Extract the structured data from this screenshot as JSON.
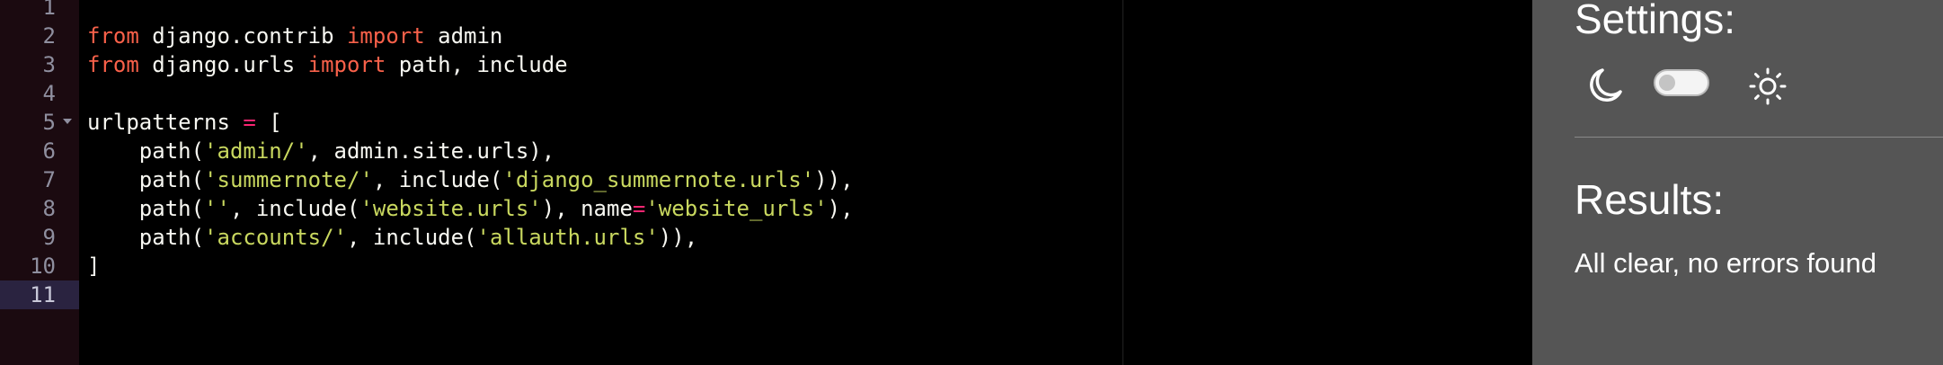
{
  "editor": {
    "lines": [
      {
        "num": "1",
        "tokens": []
      },
      {
        "num": "2",
        "tokens": [
          {
            "t": "from",
            "c": "kw"
          },
          {
            "t": " django.contrib ",
            "c": ""
          },
          {
            "t": "import",
            "c": "kw"
          },
          {
            "t": " admin",
            "c": ""
          }
        ]
      },
      {
        "num": "3",
        "tokens": [
          {
            "t": "from",
            "c": "kw"
          },
          {
            "t": " django.urls ",
            "c": ""
          },
          {
            "t": "import",
            "c": "kw"
          },
          {
            "t": " path, include",
            "c": ""
          }
        ]
      },
      {
        "num": "4",
        "tokens": []
      },
      {
        "num": "5",
        "fold": true,
        "tokens": [
          {
            "t": "urlpatterns ",
            "c": ""
          },
          {
            "t": "=",
            "c": "op"
          },
          {
            "t": " [",
            "c": ""
          }
        ]
      },
      {
        "num": "6",
        "tokens": [
          {
            "t": "    path(",
            "c": ""
          },
          {
            "t": "'admin/'",
            "c": "str"
          },
          {
            "t": ", admin.site.urls),",
            "c": ""
          }
        ]
      },
      {
        "num": "7",
        "tokens": [
          {
            "t": "    path(",
            "c": ""
          },
          {
            "t": "'summernote/'",
            "c": "str"
          },
          {
            "t": ", include(",
            "c": ""
          },
          {
            "t": "'django_summernote.urls'",
            "c": "str"
          },
          {
            "t": ")),",
            "c": ""
          }
        ]
      },
      {
        "num": "8",
        "tokens": [
          {
            "t": "    path(",
            "c": ""
          },
          {
            "t": "''",
            "c": "str"
          },
          {
            "t": ", include(",
            "c": ""
          },
          {
            "t": "'website.urls'",
            "c": "str"
          },
          {
            "t": "), name",
            "c": ""
          },
          {
            "t": "=",
            "c": "op"
          },
          {
            "t": "'website_urls'",
            "c": "str"
          },
          {
            "t": "),",
            "c": ""
          }
        ]
      },
      {
        "num": "9",
        "tokens": [
          {
            "t": "    path(",
            "c": ""
          },
          {
            "t": "'accounts/'",
            "c": "str"
          },
          {
            "t": ", include(",
            "c": ""
          },
          {
            "t": "'allauth.urls'",
            "c": "str"
          },
          {
            "t": ")),",
            "c": ""
          }
        ]
      },
      {
        "num": "10",
        "tokens": [
          {
            "t": "]",
            "c": ""
          }
        ]
      },
      {
        "num": "11",
        "active": true,
        "tokens": []
      }
    ]
  },
  "panel": {
    "settings_title": "Settings:",
    "theme_toggle": {
      "state": "off",
      "left_icon": "moon-icon",
      "right_icon": "sun-icon"
    },
    "results_title": "Results:",
    "results_text": "All clear, no errors found"
  },
  "colors": {
    "editor_bg": "#000000",
    "gutter_bg": "#1b0a10",
    "keyword": "#f9614a",
    "string": "#c9d85f",
    "operator": "#f92672",
    "panel_bg": "#555555"
  }
}
